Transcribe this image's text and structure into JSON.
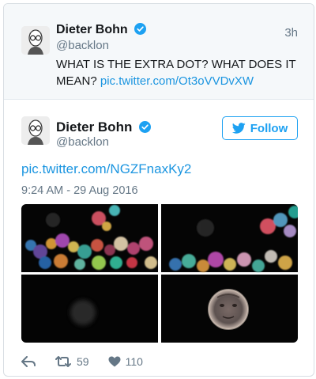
{
  "reply_tweet": {
    "author_name": "Dieter Bohn",
    "author_handle": "@backlon",
    "time_ago": "3h",
    "text_prefix": "WHAT IS THE EXTRA DOT? WHAT DOES IT MEAN? ",
    "link": "pic.twitter.com/Ot3oVVDvXW"
  },
  "main_tweet": {
    "author_name": "Dieter Bohn",
    "author_handle": "@backlon",
    "follow_label": "Follow",
    "link": "pic.twitter.com/NGZFnaxKy2",
    "timestamp": "9:24 AM - 29 Aug 2016",
    "retweet_count": "59",
    "like_count": "110"
  },
  "icons": {
    "verified": "verified-badge-icon",
    "follow_bird": "twitter-bird-icon",
    "reply": "reply-arrow-icon",
    "retweet": "retweet-icon",
    "like": "heart-icon"
  },
  "colors": {
    "brand_blue": "#1da1f2",
    "link_blue": "#1b95e0",
    "muted_gray": "#657786",
    "reply_bg": "#f5f8fa"
  }
}
